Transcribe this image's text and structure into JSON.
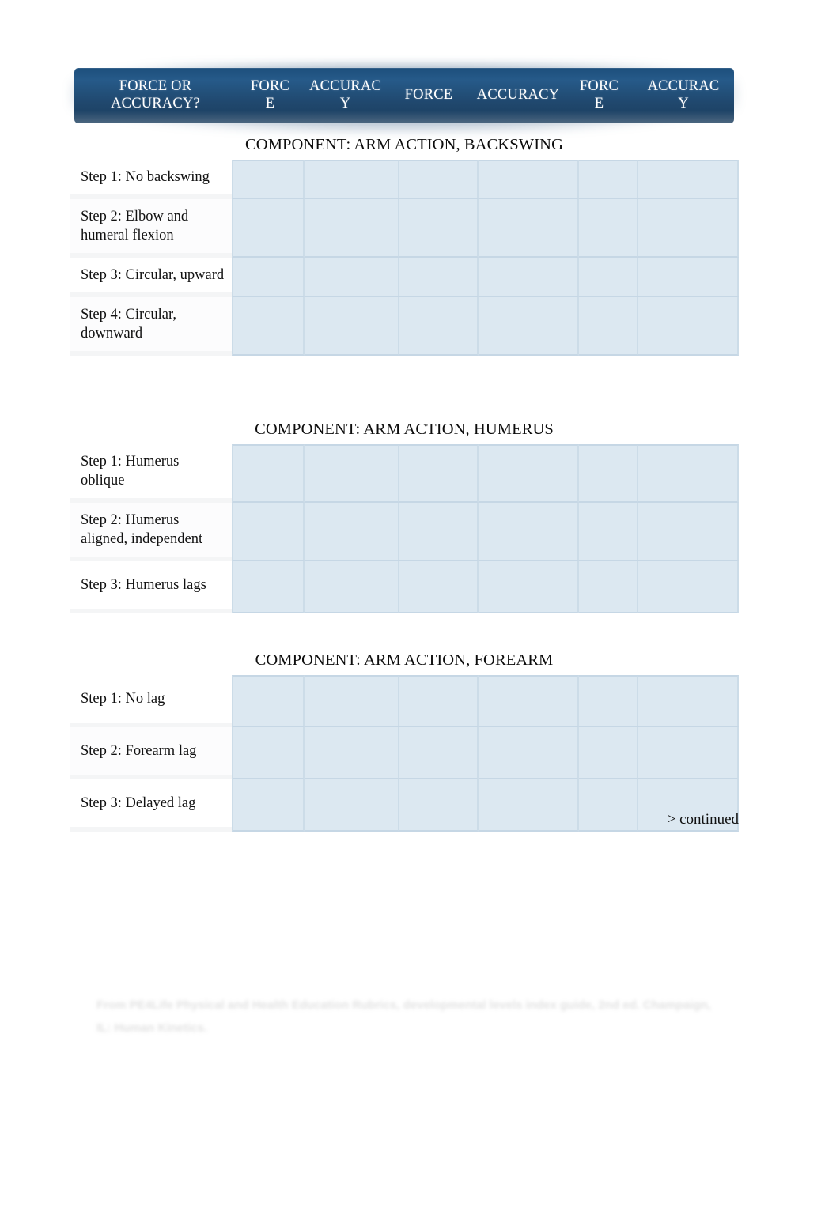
{
  "page": {
    "continued_note": "> continued",
    "footer_text": "From PE4Life Physical and Health Education Rubrics, developmental levels index guide, 2nd ed. Champaign, IL: Human Kinetics."
  },
  "header": {
    "columns": [
      {
        "label": "FORCE OR ACCURACY?",
        "lines": [
          "FORCE OR",
          "ACCURACY?"
        ]
      },
      {
        "label": "FORCE",
        "lines": [
          "FORC",
          "E"
        ]
      },
      {
        "label": "ACCURACY",
        "lines": [
          "ACCURAC",
          "Y"
        ]
      },
      {
        "label": "FORCE",
        "lines": [
          "FORCE"
        ]
      },
      {
        "label": "ACCURACY",
        "lines": [
          "ACCURACY"
        ]
      },
      {
        "label": "FORCE",
        "lines": [
          "FORC",
          "E"
        ]
      },
      {
        "label": "ACCURACY",
        "lines": [
          "ACCURAC",
          "Y"
        ]
      }
    ]
  },
  "sections": [
    {
      "title": "COMPONENT: ARM ACTION, BACKSWING",
      "rows": [
        {
          "label": "Step 1: No backswing"
        },
        {
          "label": "Step 2: Elbow and humeral flexion"
        },
        {
          "label": "Step 3: Circular, upward"
        },
        {
          "label": "Step 4: Circular, downward"
        }
      ]
    },
    {
      "title": "COMPONENT: ARM ACTION, HUMERUS",
      "rows": [
        {
          "label": "Step 1: Humerus oblique"
        },
        {
          "label": "Step 2: Humerus aligned, independent"
        },
        {
          "label": "Step 3: Humerus lags"
        }
      ]
    },
    {
      "title": "COMPONENT: ARM ACTION, FOREARM",
      "rows": [
        {
          "label": "Step 1: No lag"
        },
        {
          "label": "Step 2: Forearm lag"
        },
        {
          "label": "Step 3: Delayed lag"
        }
      ]
    }
  ],
  "colors": {
    "header_blue_dark": "#1b3d5d",
    "header_blue_mid": "#265a89",
    "cell_blue": "#dce8f1",
    "cell_grid_line": "#c6d7e5",
    "text": "#0d0d0d"
  }
}
